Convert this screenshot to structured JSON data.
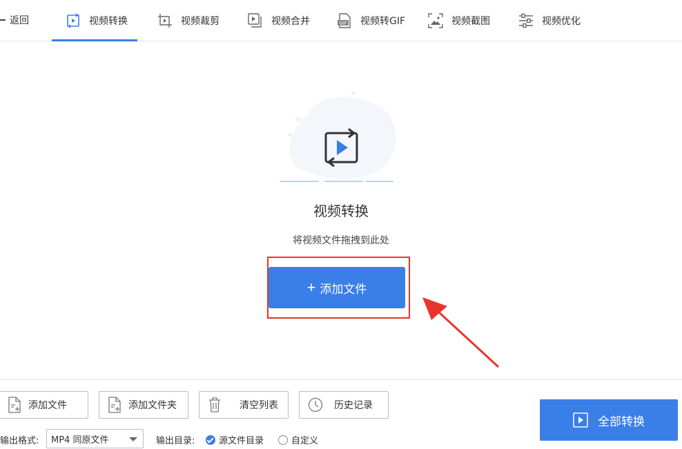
{
  "nav": {
    "back_label": "返回",
    "tabs": [
      {
        "label": "视频转换",
        "icon": "video-convert-icon",
        "active": true
      },
      {
        "label": "视频裁剪",
        "icon": "video-crop-icon",
        "active": false
      },
      {
        "label": "视频合并",
        "icon": "video-merge-icon",
        "active": false
      },
      {
        "label": "视频转GIF",
        "icon": "gif-icon",
        "active": false
      },
      {
        "label": "视频截图",
        "icon": "screenshot-icon",
        "active": false
      },
      {
        "label": "视频优化",
        "icon": "optimize-icon",
        "active": false
      }
    ],
    "gif_badge": "GIF"
  },
  "main": {
    "title": "视频转换",
    "subtitle": "将视频文件拖拽到此处",
    "add_button": {
      "plus": "+",
      "label": "添加文件"
    }
  },
  "toolbar": {
    "buttons": [
      {
        "label": "添加文件",
        "icon": "add-file-icon"
      },
      {
        "label": "添加文件夹",
        "icon": "add-folder-icon"
      },
      {
        "label": "清空列表",
        "icon": "trash-icon"
      },
      {
        "label": "历史记录",
        "icon": "clock-icon"
      }
    ],
    "format_label": "输出格式:",
    "format_value": "MP4 同原文件",
    "dir_label": "输出目录:",
    "dir_options": [
      {
        "label": "源文件目录",
        "selected": true
      },
      {
        "label": "自定义",
        "selected": false
      }
    ],
    "convert_all": "全部转换"
  },
  "colors": {
    "accent": "#3a7ee8",
    "annotation": "#e8342b"
  }
}
